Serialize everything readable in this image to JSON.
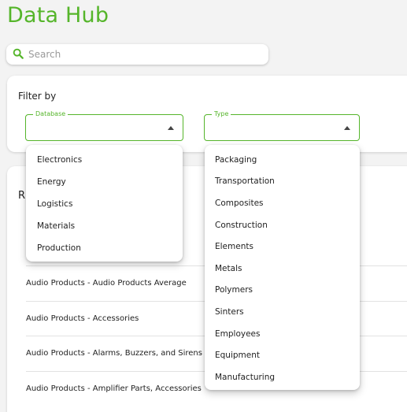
{
  "app": {
    "title": "Data Hub"
  },
  "search": {
    "placeholder": "Search",
    "value": ""
  },
  "filter": {
    "title": "Filter by",
    "database": {
      "label": "Database",
      "value": ""
    },
    "type": {
      "label": "Type",
      "value": ""
    }
  },
  "results": {
    "heading": "R",
    "rows": [
      "Audio Products - Audio Products Average",
      "Audio Products - Accessories",
      "Audio Products - Alarms, Buzzers, and Sirens",
      "Audio Products - Amplifier Parts, Accessories"
    ]
  },
  "database_options": [
    "Electronics",
    "Energy",
    "Logistics",
    "Materials",
    "Production"
  ],
  "type_options": [
    "Packaging",
    "Transportation",
    "Composites",
    "Construction",
    "Elements",
    "Metals",
    "Polymers",
    "Sinters",
    "Employees",
    "Equipment",
    "Manufacturing"
  ],
  "colors": {
    "accent": "#55b52a",
    "background": "#f3f3f3"
  },
  "icons": {
    "search": "search-icon",
    "dropdown": "caret-up-icon"
  }
}
